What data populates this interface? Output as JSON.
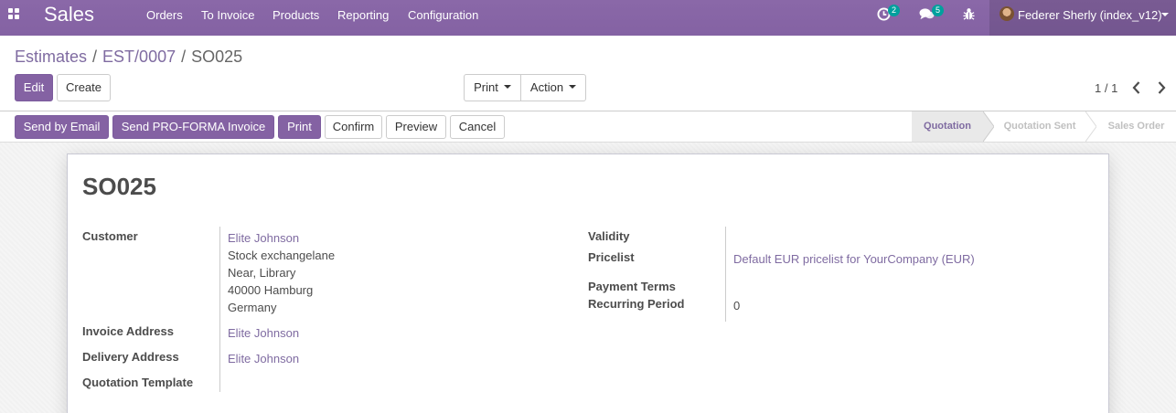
{
  "navbar": {
    "app_title": "Sales",
    "menu": [
      "Orders",
      "To Invoice",
      "Products",
      "Reporting",
      "Configuration"
    ],
    "activities_count": "2",
    "messages_count": "5",
    "user_name": "Federer Sherly (index_v12)",
    "icons": [
      "apps-grid-icon",
      "clock-activity-icon",
      "chat-bubbles-icon",
      "bug-icon",
      "avatar"
    ],
    "colors": {
      "navbar": "#8462a3",
      "accent": "#7f6ba1",
      "badge": "#00a09d"
    }
  },
  "breadcrumb": {
    "items": [
      "Estimates",
      "EST/0007"
    ],
    "current": "SO025",
    "separator": "/"
  },
  "control_buttons": {
    "edit": "Edit",
    "create": "Create",
    "print": "Print",
    "action": "Action"
  },
  "pager": {
    "value": "1 / 1"
  },
  "header_buttons": {
    "send_by_email": "Send by Email",
    "send_proforma": "Send PRO-FORMA Invoice",
    "print": "Print",
    "confirm": "Confirm",
    "preview": "Preview",
    "cancel": "Cancel"
  },
  "statusbar": {
    "steps": [
      "Quotation",
      "Quotation Sent",
      "Sales Order"
    ],
    "active": "Quotation"
  },
  "form": {
    "name": "SO025",
    "customer_label": "Customer",
    "customer_name": "Elite Johnson",
    "customer_address": [
      "Stock exchangelane",
      "Near, Library",
      "40000 Hamburg",
      "Germany"
    ],
    "invoice_address_label": "Invoice Address",
    "invoice_address": "Elite Johnson",
    "delivery_address_label": "Delivery Address",
    "delivery_address": "Elite Johnson",
    "quotation_template_label": "Quotation Template",
    "validity_label": "Validity",
    "pricelist_label": "Pricelist",
    "pricelist": "Default EUR pricelist for YourCompany (EUR)",
    "payment_terms_label": "Payment Terms",
    "recurring_period_label": "Recurring Period",
    "recurring_period": "0"
  }
}
